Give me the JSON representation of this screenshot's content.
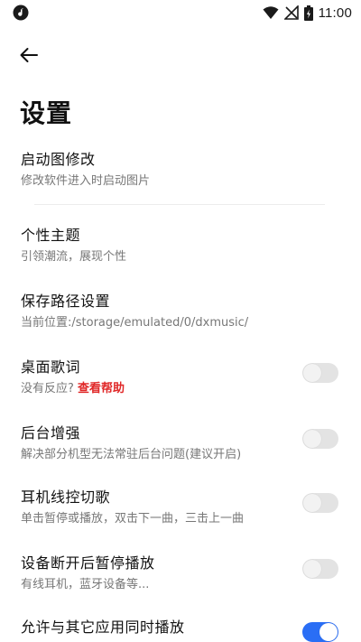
{
  "status_bar": {
    "time": "11:00",
    "icons": [
      "app-notification-icon",
      "wifi-icon",
      "signal-icon",
      "battery-icon"
    ]
  },
  "header": {
    "back_icon": "arrow-left-icon",
    "title": "设置"
  },
  "settings": [
    {
      "id": "launch-image",
      "title": "启动图修改",
      "subtitle": "修改软件进入时启动图片",
      "has_toggle": false
    },
    {
      "id": "theme",
      "title": "个性主题",
      "subtitle": "引领潮流，展现个性",
      "has_toggle": false
    },
    {
      "id": "save-path",
      "title": "保存路径设置",
      "subtitle": "当前位置:/storage/emulated/0/dxmusic/",
      "has_toggle": false
    },
    {
      "id": "desktop-lyrics",
      "title": "桌面歌词",
      "subtitle": "没有反应?",
      "link": "查看帮助",
      "has_toggle": true,
      "enabled": false
    },
    {
      "id": "background-boost",
      "title": "后台增强",
      "subtitle": "解决部分机型无法常驻后台问题(建议开启)",
      "has_toggle": true,
      "enabled": false
    },
    {
      "id": "headset-control",
      "title": "耳机线控切歌",
      "subtitle": "单击暂停或播放，双击下一曲，三击上一曲",
      "has_toggle": true,
      "enabled": false
    },
    {
      "id": "pause-on-disconnect",
      "title": "设备断开后暂停播放",
      "subtitle": "有线耳机，蓝牙设备等...",
      "has_toggle": true,
      "enabled": false
    },
    {
      "id": "mix-playback",
      "title": "允许与其它应用同时播放",
      "subtitle": "",
      "has_toggle": true,
      "enabled": true
    }
  ],
  "colors": {
    "accent": "#2a6ef5",
    "link": "#e02828",
    "toggle_off": "#e3e3e3"
  }
}
